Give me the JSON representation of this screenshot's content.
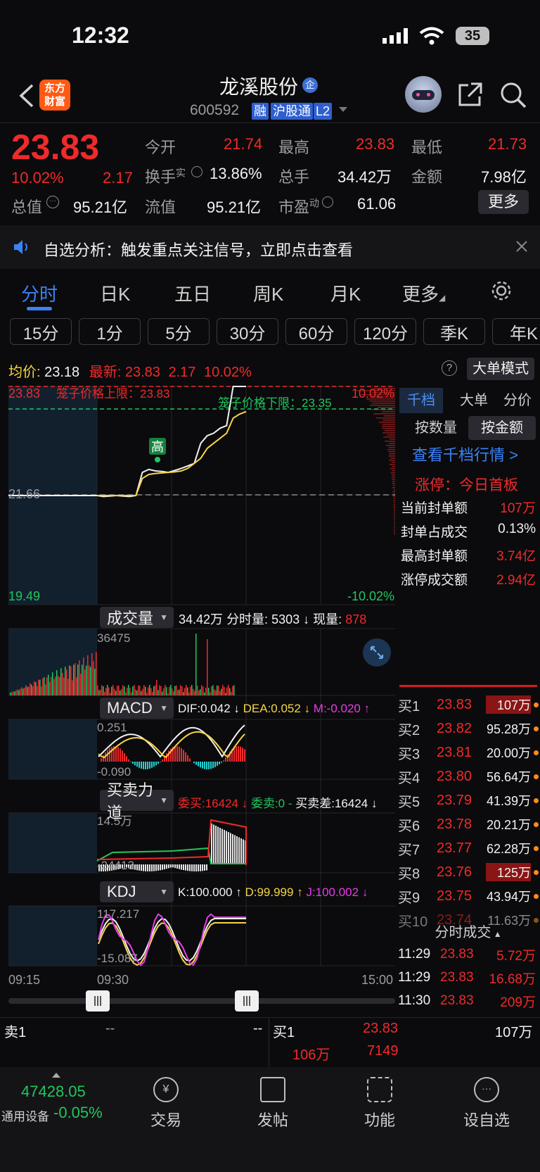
{
  "status_bar": {
    "time": "12:32",
    "battery": "35"
  },
  "header": {
    "brand_badge_line1": "东方",
    "brand_badge_line2": "财富",
    "stock_name": "龙溪股份",
    "enterprise_tag": "企",
    "stock_code": "600592",
    "tags": [
      "融",
      "沪股通",
      "L2"
    ]
  },
  "quote": {
    "price": "23.83",
    "change_pct": "10.02%",
    "change": "2.17",
    "open_label": "今开",
    "open": "21.74",
    "high_label": "最高",
    "high": "23.83",
    "low_label": "最低",
    "low": "21.73",
    "turnover_label": "换手",
    "turnover_sup": "实",
    "turnover": "13.86%",
    "volume_label": "总手",
    "volume": "34.42万",
    "amount_label": "金额",
    "amount": "7.98亿",
    "mktcap_label": "总值",
    "mktcap": "95.21亿",
    "float_label": "流值",
    "float_cap": "95.21亿",
    "pe_label": "市盈",
    "pe_sup": "动",
    "pe": "61.06",
    "more_button": "更多"
  },
  "alert": {
    "text": "自选分析：触发重点关注信号，立即点击查看"
  },
  "main_tabs": [
    "分时",
    "日K",
    "五日",
    "周K",
    "月K",
    "更多"
  ],
  "active_main_tab": "分时",
  "timeframes": [
    "15分",
    "1分",
    "5分",
    "30分",
    "60分",
    "120分",
    "季K",
    "年K"
  ],
  "chart_header": {
    "avg_label": "均价:",
    "avg": "23.18",
    "latest_label": "最新:",
    "latest": "23.83",
    "latest_change": "2.17",
    "latest_pct": "10.02%",
    "big_order_button": "大单模式"
  },
  "right_panel": {
    "tabs": [
      "千档",
      "大单",
      "分价"
    ],
    "subtabs": [
      "按数量",
      "按金额"
    ],
    "view_link": "查看千档行情 >",
    "limit_title": "涨停：今日首板",
    "stats": [
      {
        "label": "当前封单额",
        "value": "107万"
      },
      {
        "label": "封单占成交",
        "value": "0.13%"
      },
      {
        "label": "最高封单额",
        "value": "3.74亿"
      },
      {
        "label": "涨停成交额",
        "value": "2.94亿"
      }
    ],
    "bids": [
      {
        "label": "买1",
        "price": "23.83",
        "vol": "107万"
      },
      {
        "label": "买2",
        "price": "23.82",
        "vol": "95.28万"
      },
      {
        "label": "买3",
        "price": "23.81",
        "vol": "20.00万"
      },
      {
        "label": "买4",
        "price": "23.80",
        "vol": "56.64万"
      },
      {
        "label": "买5",
        "price": "23.79",
        "vol": "41.39万"
      },
      {
        "label": "买6",
        "price": "23.78",
        "vol": "20.21万"
      },
      {
        "label": "买7",
        "price": "23.77",
        "vol": "62.28万"
      },
      {
        "label": "买8",
        "price": "23.76",
        "vol": "125万"
      },
      {
        "label": "买9",
        "price": "23.75",
        "vol": "43.94万"
      },
      {
        "label": "买10",
        "price": "23.74",
        "vol": "11.63万"
      }
    ],
    "ticks_title": "分时成交",
    "ticks": [
      {
        "time": "11:29",
        "price": "23.83",
        "vol": "5.72万"
      },
      {
        "time": "11:29",
        "price": "23.83",
        "vol": "16.68万"
      },
      {
        "time": "11:30",
        "price": "23.83",
        "vol": "209万"
      }
    ]
  },
  "chart_data": {
    "type": "line",
    "price_axis": {
      "top": "23.83",
      "mid": "21.66",
      "bottom": "19.49",
      "top_pct": "10.02%",
      "bottom_pct": "-10.02%"
    },
    "cage_upper_label": "笼子价格上限：23.83",
    "cage_lower_label": "笼子价格下限：23.35",
    "high_marker": "高",
    "price_series": [
      21.66,
      21.64,
      21.65,
      21.66,
      21.65,
      21.64,
      21.66,
      22.12,
      22.18,
      22.15,
      22.14,
      22.12,
      22.16,
      22.2,
      22.25,
      22.3,
      22.7,
      22.85,
      22.9,
      23.0,
      23.05,
      23.83,
      23.83,
      23.83
    ],
    "avg_series": [
      21.66,
      21.66,
      21.66,
      21.66,
      21.66,
      21.66,
      21.66,
      22.0,
      22.08,
      22.1,
      22.11,
      22.12,
      22.13,
      22.15,
      22.2,
      22.3,
      22.4,
      22.6,
      22.7,
      22.8,
      22.9,
      23.2,
      23.28,
      23.33
    ],
    "x_labels": [
      "09:15",
      "09:30",
      "15:00"
    ],
    "volume": {
      "label": "成交量",
      "total": "34.42万",
      "minute_label": "分时量:",
      "minute": "5303",
      "current_label": "现量:",
      "current": "878",
      "axis_max": "36475"
    },
    "macd": {
      "label": "MACD",
      "dif": "DIF:0.042",
      "dea": "DEA:0.052",
      "m": "M:-0.020",
      "axis_max": "0.251",
      "axis_min": "-0.090"
    },
    "force": {
      "label": "买卖力道",
      "buy": "委买:16424",
      "sell": "委卖:0",
      "diff": "买卖差:16424",
      "axis_max": "14.5万",
      "axis_min": "-24413"
    },
    "kdj": {
      "label": "KDJ",
      "k": "K:100.000",
      "d": "D:99.999",
      "j": "J:100.002",
      "axis_max": "117.217",
      "axis_min": "-15.087"
    }
  },
  "bottom_orders": {
    "sell_label": "卖1",
    "sell_price": "--",
    "sell_vol": "--",
    "buy_label": "买1",
    "buy_price": "23.83",
    "buy_vol": "107万",
    "extra_vol": "106万",
    "extra_count": "7149"
  },
  "bottom_nav": {
    "index_value": "47428.05",
    "index_name": "通用设备",
    "index_change": "-0.05%",
    "items": [
      "交易",
      "发帖",
      "功能",
      "设自选"
    ]
  }
}
